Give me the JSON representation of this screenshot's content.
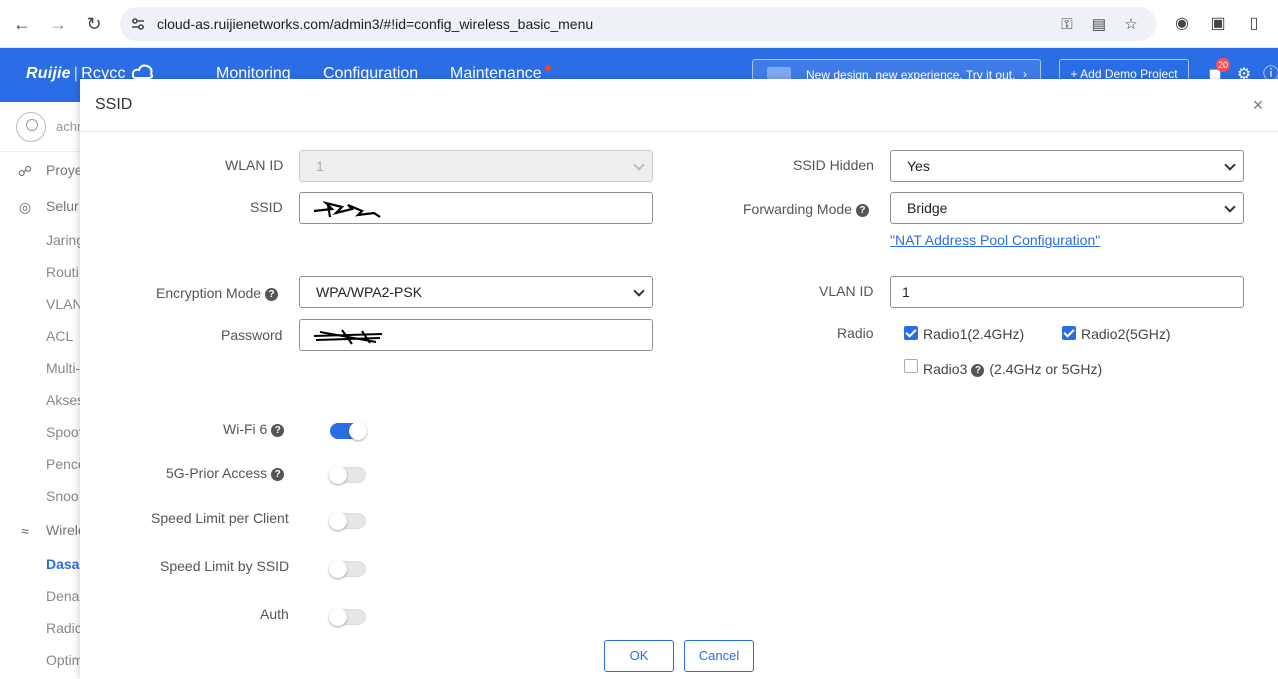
{
  "browser": {
    "url": "cloud-as.ruijienetworks.com/admin3/#!id=config_wireless_basic_menu"
  },
  "header": {
    "logo_brand": "Ruijie",
    "logo_sep": "|",
    "logo_product": "Rcycc",
    "nav": [
      "Monitoring",
      "Configuration",
      "Maintenance"
    ],
    "banner_text": "New design, new experience. Try it out.",
    "demo_button": "+ Add Demo Project",
    "notification_count": "20"
  },
  "sidebar": {
    "user": "achm",
    "items": [
      "Proye",
      "Selur",
      "Jaring",
      "Routi",
      "VLAN",
      "ACL",
      "Multi-",
      "Akses",
      "Spoof",
      "Pence",
      "Snoo",
      "Wirele",
      "Dasa",
      "Dena",
      "Radic",
      "Optim"
    ]
  },
  "modal": {
    "title": "SSID",
    "close": "×",
    "wlan_id_label": "WLAN ID",
    "wlan_id_value": "1",
    "ssid_label": "SSID",
    "encryption_label": "Encryption Mode",
    "encryption_value": "WPA/WPA2-PSK",
    "password_label": "Password",
    "ssid_hidden_label": "SSID Hidden",
    "ssid_hidden_value": "Yes",
    "forwarding_label": "Forwarding Mode",
    "forwarding_value": "Bridge",
    "nat_link": "\"NAT Address Pool Configuration\"",
    "vlan_label": "VLAN ID",
    "vlan_value": "1",
    "radio_label": "Radio",
    "radio1": "Radio1(2.4GHz)",
    "radio2": "Radio2(5GHz)",
    "radio3": "Radio3",
    "radio3_note": "(2.4GHz or 5GHz)",
    "wifi6_label": "Wi-Fi 6",
    "prior_label": "5G-Prior Access",
    "speed_client_label": "Speed Limit per Client",
    "speed_ssid_label": "Speed Limit by SSID",
    "auth_label": "Auth",
    "ok": "OK",
    "cancel": "Cancel",
    "help_glyph": "?"
  },
  "colors": {
    "accent": "#2b6de4"
  }
}
